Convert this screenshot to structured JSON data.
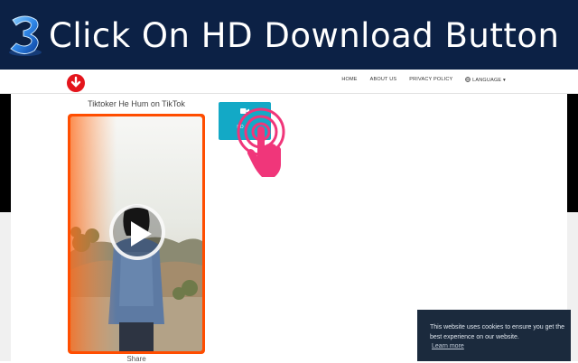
{
  "banner": {
    "title": "Click On HD Download Button",
    "step_number": "3",
    "background": "#0c2145"
  },
  "navbar": {
    "links": [
      "HOME",
      "ABOUT US",
      "PRIVACY POLICY",
      "LANGUAGE"
    ],
    "language_icon": "globe-icon",
    "language_caret": "▾",
    "logo_color": "#e4151c"
  },
  "video": {
    "title": "Tiktoker He Hum on TikTok",
    "share_label": "Share",
    "frame_accent": "#ff4d00"
  },
  "hd_button": {
    "label": "HD",
    "icon": "video-camera-icon",
    "color": "#13a9c6"
  },
  "tap_indicator": {
    "icon": "tap-hand-icon",
    "color": "#f0367a"
  },
  "cookie": {
    "message": "This website uses cookies to ensure you get the best experience on our website.",
    "learn_more": "Learn more"
  }
}
